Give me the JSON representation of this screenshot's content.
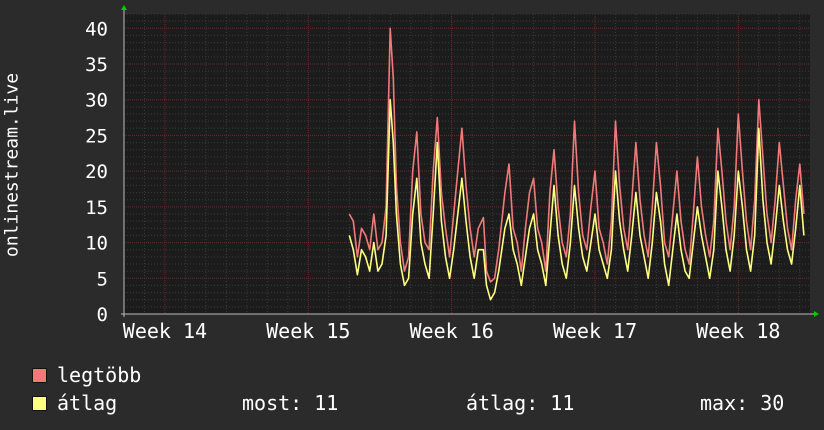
{
  "chart_data": {
    "type": "line",
    "ylabel": "onlinestream.live",
    "ylim": [
      0,
      42
    ],
    "yticks": [
      0,
      5,
      10,
      15,
      20,
      25,
      30,
      35,
      40
    ],
    "xticks": [
      {
        "label": "Week 14",
        "at": 0
      },
      {
        "label": "Week 15",
        "at": 7
      },
      {
        "label": "Week 16",
        "at": 14
      },
      {
        "label": "Week 17",
        "at": 21
      },
      {
        "label": "Week 18",
        "at": 28
      }
    ],
    "xlim": [
      -2,
      31.5
    ],
    "series": [
      {
        "name": "legtöbb",
        "color": "#f07a7a",
        "points": [
          [
            9.0,
            14
          ],
          [
            9.2,
            13
          ],
          [
            9.4,
            8
          ],
          [
            9.6,
            12
          ],
          [
            9.8,
            11
          ],
          [
            10.0,
            9
          ],
          [
            10.2,
            14
          ],
          [
            10.4,
            9
          ],
          [
            10.6,
            10
          ],
          [
            10.8,
            15
          ],
          [
            11.0,
            40
          ],
          [
            11.15,
            33
          ],
          [
            11.3,
            18
          ],
          [
            11.5,
            10
          ],
          [
            11.7,
            6
          ],
          [
            11.9,
            8
          ],
          [
            12.1,
            20
          ],
          [
            12.3,
            25.5
          ],
          [
            12.5,
            14
          ],
          [
            12.7,
            10
          ],
          [
            12.9,
            9
          ],
          [
            13.1,
            20
          ],
          [
            13.3,
            27.5
          ],
          [
            13.5,
            17
          ],
          [
            13.7,
            12
          ],
          [
            13.9,
            8
          ],
          [
            14.1,
            14
          ],
          [
            14.3,
            20
          ],
          [
            14.5,
            26
          ],
          [
            14.7,
            18
          ],
          [
            14.9,
            12
          ],
          [
            15.1,
            8
          ],
          [
            15.3,
            12
          ],
          [
            15.55,
            13.5
          ],
          [
            15.7,
            6
          ],
          [
            15.9,
            4.5
          ],
          [
            16.1,
            5
          ],
          [
            16.3,
            9
          ],
          [
            16.6,
            17
          ],
          [
            16.8,
            21
          ],
          [
            17.0,
            12
          ],
          [
            17.2,
            10
          ],
          [
            17.4,
            6
          ],
          [
            17.6,
            12
          ],
          [
            17.8,
            17
          ],
          [
            18.0,
            19
          ],
          [
            18.2,
            12
          ],
          [
            18.4,
            10
          ],
          [
            18.6,
            6
          ],
          [
            18.8,
            17
          ],
          [
            19.0,
            23
          ],
          [
            19.2,
            15
          ],
          [
            19.4,
            10
          ],
          [
            19.6,
            8
          ],
          [
            19.8,
            14
          ],
          [
            20.0,
            27
          ],
          [
            20.2,
            17
          ],
          [
            20.4,
            11
          ],
          [
            20.6,
            9
          ],
          [
            20.8,
            15
          ],
          [
            21.0,
            20
          ],
          [
            21.2,
            12
          ],
          [
            21.4,
            10
          ],
          [
            21.6,
            7
          ],
          [
            21.8,
            13
          ],
          [
            22.0,
            27
          ],
          [
            22.2,
            18
          ],
          [
            22.4,
            12
          ],
          [
            22.6,
            9
          ],
          [
            22.8,
            16
          ],
          [
            23.0,
            24
          ],
          [
            23.2,
            16
          ],
          [
            23.4,
            11
          ],
          [
            23.6,
            8
          ],
          [
            23.8,
            15
          ],
          [
            24.0,
            24
          ],
          [
            24.2,
            18
          ],
          [
            24.4,
            10
          ],
          [
            24.6,
            8
          ],
          [
            24.8,
            14
          ],
          [
            25.0,
            20
          ],
          [
            25.2,
            13
          ],
          [
            25.4,
            9
          ],
          [
            25.6,
            7
          ],
          [
            25.8,
            14
          ],
          [
            26.0,
            22
          ],
          [
            26.2,
            15
          ],
          [
            26.4,
            11
          ],
          [
            26.6,
            8
          ],
          [
            26.8,
            13
          ],
          [
            27.0,
            26
          ],
          [
            27.2,
            20
          ],
          [
            27.4,
            13
          ],
          [
            27.6,
            9
          ],
          [
            27.8,
            15
          ],
          [
            28.0,
            28
          ],
          [
            28.2,
            20
          ],
          [
            28.4,
            13
          ],
          [
            28.6,
            9
          ],
          [
            28.8,
            16
          ],
          [
            29.0,
            30
          ],
          [
            29.2,
            22
          ],
          [
            29.4,
            14
          ],
          [
            29.6,
            10
          ],
          [
            29.8,
            16
          ],
          [
            30.0,
            24
          ],
          [
            30.2,
            18
          ],
          [
            30.4,
            12
          ],
          [
            30.6,
            9
          ],
          [
            30.8,
            16
          ],
          [
            31.0,
            21
          ],
          [
            31.2,
            14
          ]
        ]
      },
      {
        "name": "átlag",
        "color": "#ffff80",
        "points": [
          [
            9.0,
            11
          ],
          [
            9.2,
            9
          ],
          [
            9.4,
            5.5
          ],
          [
            9.6,
            9
          ],
          [
            9.8,
            8
          ],
          [
            10.0,
            6
          ],
          [
            10.2,
            10
          ],
          [
            10.4,
            6
          ],
          [
            10.6,
            7
          ],
          [
            10.8,
            11
          ],
          [
            11.0,
            30
          ],
          [
            11.15,
            24
          ],
          [
            11.3,
            14
          ],
          [
            11.5,
            7
          ],
          [
            11.7,
            4
          ],
          [
            11.9,
            5
          ],
          [
            12.1,
            14
          ],
          [
            12.3,
            19
          ],
          [
            12.5,
            10
          ],
          [
            12.7,
            7
          ],
          [
            12.9,
            5
          ],
          [
            13.1,
            14
          ],
          [
            13.3,
            24
          ],
          [
            13.5,
            13
          ],
          [
            13.7,
            8
          ],
          [
            13.9,
            5
          ],
          [
            14.1,
            9
          ],
          [
            14.3,
            14
          ],
          [
            14.5,
            19
          ],
          [
            14.7,
            13
          ],
          [
            14.9,
            8
          ],
          [
            15.1,
            5
          ],
          [
            15.3,
            9
          ],
          [
            15.55,
            9
          ],
          [
            15.7,
            4
          ],
          [
            15.9,
            2
          ],
          [
            16.1,
            3
          ],
          [
            16.3,
            6
          ],
          [
            16.6,
            12
          ],
          [
            16.8,
            14
          ],
          [
            17.0,
            9
          ],
          [
            17.2,
            7
          ],
          [
            17.4,
            4
          ],
          [
            17.6,
            8
          ],
          [
            17.8,
            12
          ],
          [
            18.0,
            14
          ],
          [
            18.2,
            9
          ],
          [
            18.4,
            7
          ],
          [
            18.6,
            4
          ],
          [
            18.8,
            11
          ],
          [
            19.0,
            18
          ],
          [
            19.2,
            11
          ],
          [
            19.4,
            7
          ],
          [
            19.6,
            5
          ],
          [
            19.8,
            10
          ],
          [
            20.0,
            18
          ],
          [
            20.2,
            12
          ],
          [
            20.4,
            8
          ],
          [
            20.6,
            6
          ],
          [
            20.8,
            10
          ],
          [
            21.0,
            14
          ],
          [
            21.2,
            9
          ],
          [
            21.4,
            7
          ],
          [
            21.6,
            5
          ],
          [
            21.8,
            9
          ],
          [
            22.0,
            20
          ],
          [
            22.2,
            13
          ],
          [
            22.4,
            9
          ],
          [
            22.6,
            6
          ],
          [
            22.8,
            11
          ],
          [
            23.0,
            17
          ],
          [
            23.2,
            11
          ],
          [
            23.4,
            8
          ],
          [
            23.6,
            5
          ],
          [
            23.8,
            10
          ],
          [
            24.0,
            17
          ],
          [
            24.2,
            13
          ],
          [
            24.4,
            7
          ],
          [
            24.6,
            4
          ],
          [
            24.8,
            9
          ],
          [
            25.0,
            14
          ],
          [
            25.2,
            9
          ],
          [
            25.4,
            6
          ],
          [
            25.6,
            5
          ],
          [
            25.8,
            10
          ],
          [
            26.0,
            15
          ],
          [
            26.2,
            11
          ],
          [
            26.4,
            8
          ],
          [
            26.6,
            5
          ],
          [
            26.8,
            9
          ],
          [
            27.0,
            20
          ],
          [
            27.2,
            15
          ],
          [
            27.4,
            9
          ],
          [
            27.6,
            6
          ],
          [
            27.8,
            11
          ],
          [
            28.0,
            20
          ],
          [
            28.2,
            15
          ],
          [
            28.4,
            9
          ],
          [
            28.6,
            6
          ],
          [
            28.8,
            11
          ],
          [
            29.0,
            26
          ],
          [
            29.2,
            16
          ],
          [
            29.4,
            10
          ],
          [
            29.6,
            7
          ],
          [
            29.8,
            12
          ],
          [
            30.0,
            18
          ],
          [
            30.2,
            13
          ],
          [
            30.4,
            9
          ],
          [
            30.6,
            7
          ],
          [
            30.8,
            12
          ],
          [
            31.0,
            18
          ],
          [
            31.2,
            11
          ]
        ]
      }
    ],
    "colors": {
      "background": "#2b2b2b",
      "plot_background": "#1c1c1c",
      "minor_grid": "#3a3a3a",
      "major_grid": "#6a2a2a",
      "arrow": "#00cc00",
      "text": "#ffffff"
    }
  },
  "legend": {
    "max_label": "legtöbb",
    "avg_label": "átlag",
    "now": "most: 11",
    "avg": "átlag: 11",
    "max": "max: 30"
  }
}
